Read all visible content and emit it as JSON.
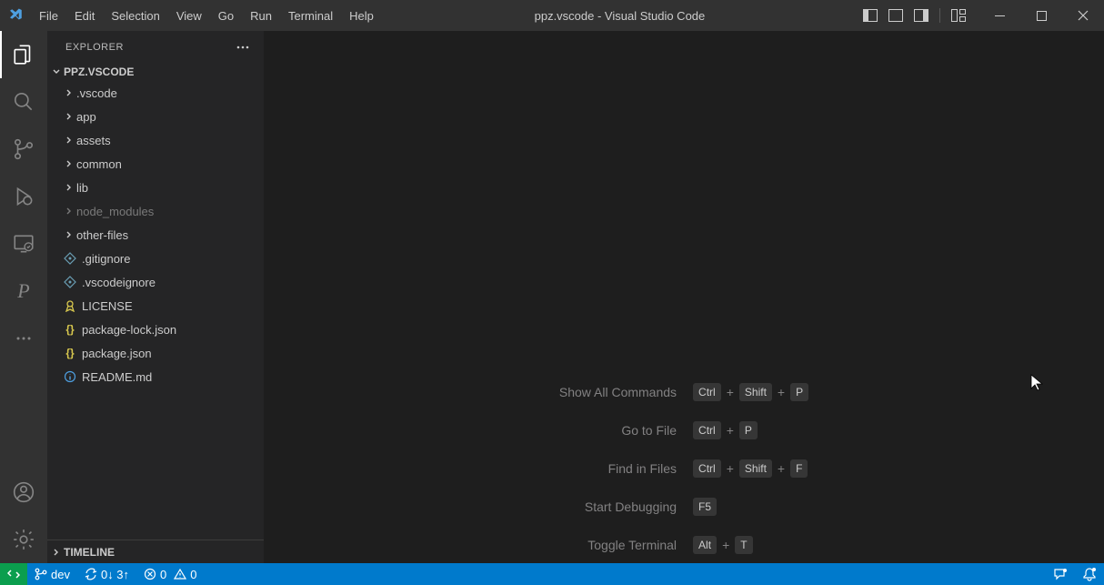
{
  "titlebar": {
    "menus": [
      "File",
      "Edit",
      "Selection",
      "View",
      "Go",
      "Run",
      "Terminal",
      "Help"
    ],
    "title": "ppz.vscode - Visual Studio Code"
  },
  "sidebar": {
    "explorer_label": "EXPLORER",
    "project_name": "PPZ.VSCODE",
    "timeline_label": "TIMELINE",
    "items": [
      {
        "type": "folder",
        "label": ".vscode"
      },
      {
        "type": "folder",
        "label": "app"
      },
      {
        "type": "folder",
        "label": "assets"
      },
      {
        "type": "folder",
        "label": "common"
      },
      {
        "type": "folder",
        "label": "lib"
      },
      {
        "type": "folder",
        "label": "node_modules",
        "dim": true
      },
      {
        "type": "folder",
        "label": "other-files"
      },
      {
        "type": "file",
        "label": ".gitignore",
        "icon": "git"
      },
      {
        "type": "file",
        "label": ".vscodeignore",
        "icon": "git"
      },
      {
        "type": "file",
        "label": "LICENSE",
        "icon": "license"
      },
      {
        "type": "file",
        "label": "package-lock.json",
        "icon": "json"
      },
      {
        "type": "file",
        "label": "package.json",
        "icon": "json"
      },
      {
        "type": "file",
        "label": "README.md",
        "icon": "info"
      }
    ]
  },
  "welcome": {
    "hints": [
      {
        "label": "Show All Commands",
        "keys": [
          "Ctrl",
          "Shift",
          "P"
        ]
      },
      {
        "label": "Go to File",
        "keys": [
          "Ctrl",
          "P"
        ]
      },
      {
        "label": "Find in Files",
        "keys": [
          "Ctrl",
          "Shift",
          "F"
        ]
      },
      {
        "label": "Start Debugging",
        "keys": [
          "F5"
        ]
      },
      {
        "label": "Toggle Terminal",
        "keys": [
          "Alt",
          "T"
        ]
      }
    ]
  },
  "statusbar": {
    "branch": "dev",
    "sync": "0↓ 3↑",
    "errors": "0",
    "warnings": "0"
  }
}
